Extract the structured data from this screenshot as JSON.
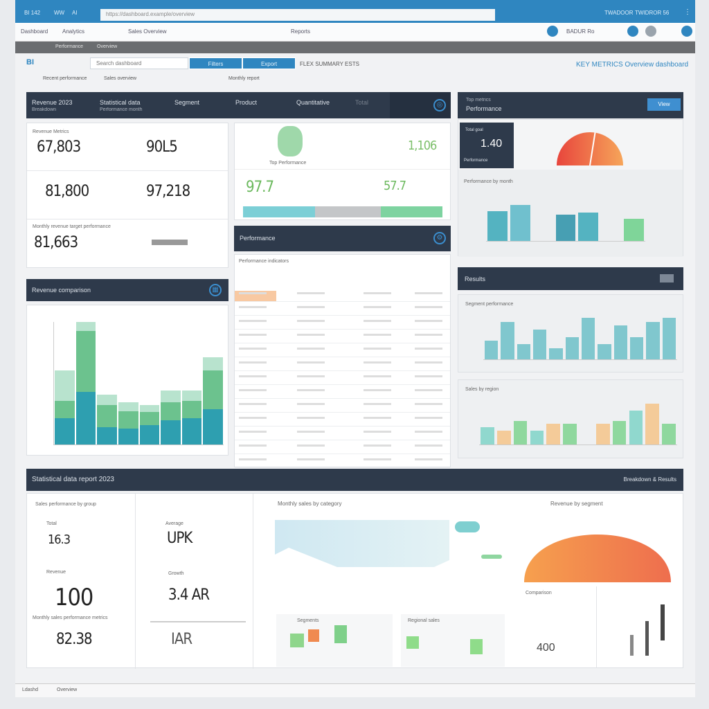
{
  "browser": {
    "tabs": [
      "BI 142",
      "WW",
      "AI"
    ],
    "address": "https://dashboard.example/overview",
    "right_tabs": [
      "TWADOOR",
      "TWIDROR 56"
    ],
    "toolbar_items": [
      "Dashboard",
      "Analytics",
      "Sales Overview",
      "Reports"
    ],
    "toolbar_right": "BADUR Ro"
  },
  "nav": {
    "items": [
      "Performance",
      "Overview"
    ]
  },
  "header": {
    "logo": "BI",
    "search_placeholder": "Search dashboard",
    "buttons": [
      "Filters",
      "Export"
    ],
    "status": "FLEX SUMMARY ESTS",
    "headline": "KEY METRICS Overview dashboard",
    "links": [
      "Recent performance",
      "Sales overview",
      "Monthly report"
    ]
  },
  "summary_bar": {
    "columns": [
      {
        "title": "Revenue 2023",
        "sub": "Breakdown"
      },
      {
        "title": "Statistical data",
        "sub": "Performance month"
      },
      {
        "title": "Segment"
      },
      {
        "title": "Product"
      },
      {
        "title": "Quantitative"
      },
      {
        "title": "Total"
      }
    ]
  },
  "kpis": {
    "label_top": "Revenue Metrics",
    "rows": [
      [
        "67,803",
        "90L5"
      ],
      [
        "81,800",
        "97,218"
      ],
      [
        "81,663",
        ""
      ]
    ],
    "label_bottom": "Monthly revenue target performance"
  },
  "middle": {
    "caption": "Top Performance",
    "values": [
      "1,106",
      "97.7",
      "57.7"
    ],
    "progress": {
      "segments": [
        {
          "color": "#7ccfd6",
          "share": 0.36
        },
        {
          "color": "#c4c6c8",
          "share": 0.33
        },
        {
          "color": "#7ed3a0",
          "share": 0.31
        }
      ]
    }
  },
  "right_top": {
    "header": "Top metrics",
    "sub": "Performance",
    "button": "View",
    "kpi_label": "Total goal",
    "kpi_value": "1.40",
    "kpi_footer": "Performance",
    "chart_title": "Performance by month",
    "gauge_fraction": 0.55
  },
  "performance": {
    "title": "Performance",
    "table_title": "Performance indicators",
    "rows": 13
  },
  "left_chart": {
    "title": "Revenue comparison"
  },
  "results": {
    "title": "Results",
    "chart1_title": "Segment performance",
    "chart2_title": "Sales by region"
  },
  "bottom": {
    "title": "Statistical data report 2023",
    "right": "Breakdown & Results",
    "kpi_section_title": "Sales performance by group",
    "values": [
      "16.3",
      "UPK",
      "100",
      "3.4 AR",
      "82.38",
      "IAR"
    ],
    "labels": [
      "Total",
      "Average",
      "Revenue",
      "Growth",
      "Monthly sales performance metrics"
    ],
    "area_title": "Monthly sales by category",
    "pie_title": "Revenue by segment",
    "sub_titles": [
      "Segments",
      "Regional sales",
      "Comparison"
    ],
    "sub_value": "400"
  },
  "footer": {
    "items": [
      "Ldashd",
      "Overview"
    ]
  },
  "chart_data": [
    {
      "type": "bar",
      "name": "left_chart",
      "stacks": [
        [
          30,
          20,
          35
        ],
        [
          60,
          70,
          10
        ],
        [
          20,
          25,
          12
        ],
        [
          18,
          20,
          10
        ],
        [
          22,
          15,
          8
        ],
        [
          28,
          20,
          14
        ],
        [
          30,
          20,
          12
        ],
        [
          40,
          45,
          15
        ]
      ],
      "colors": [
        "#2e9fb0",
        "#6cc28e",
        "#b8e3ce"
      ]
    },
    {
      "type": "bar",
      "name": "right_top_bars",
      "values": [
        40,
        48,
        0,
        35,
        38,
        0,
        30
      ],
      "colors": [
        "#3aa8b8",
        "#5bb7c8",
        "#dfe3e6",
        "#2a90a8",
        "#3aa8b8",
        "#dfe3e6",
        "#6cd08a"
      ]
    },
    {
      "type": "bar",
      "name": "results_chart1",
      "values": [
        25,
        50,
        20,
        40,
        15,
        30,
        55,
        20,
        45,
        30,
        50,
        55
      ],
      "colors": [
        "#6cc0c8"
      ]
    },
    {
      "type": "bar",
      "name": "results_chart2",
      "values": [
        25,
        20,
        35,
        20,
        30,
        30,
        0,
        30,
        35,
        50,
        60,
        30
      ],
      "colors": [
        "#7fd3c8",
        "#f4c48a",
        "#7ed38f"
      ]
    }
  ]
}
